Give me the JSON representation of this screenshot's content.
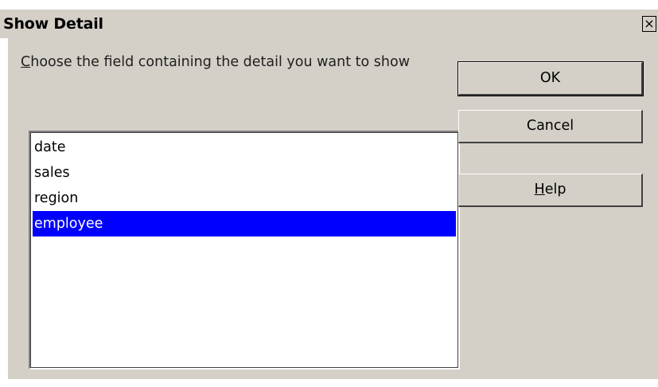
{
  "window": {
    "title": "Show Detail",
    "close_glyph": "×"
  },
  "prompt": {
    "access_key": "C",
    "text_rest": "hoose the field containing the detail you want to show"
  },
  "fields": {
    "items": [
      {
        "label": "date",
        "selected": false
      },
      {
        "label": "sales",
        "selected": false
      },
      {
        "label": "region",
        "selected": false
      },
      {
        "label": "employee",
        "selected": true
      }
    ]
  },
  "buttons": {
    "ok_label": "OK",
    "cancel_label": "Cancel",
    "help_access_key": "H",
    "help_rest": "elp"
  },
  "colors": {
    "dialog_bg": "#d4d0c8",
    "selection_bg": "#0000ff",
    "selection_fg": "#ffffff"
  }
}
